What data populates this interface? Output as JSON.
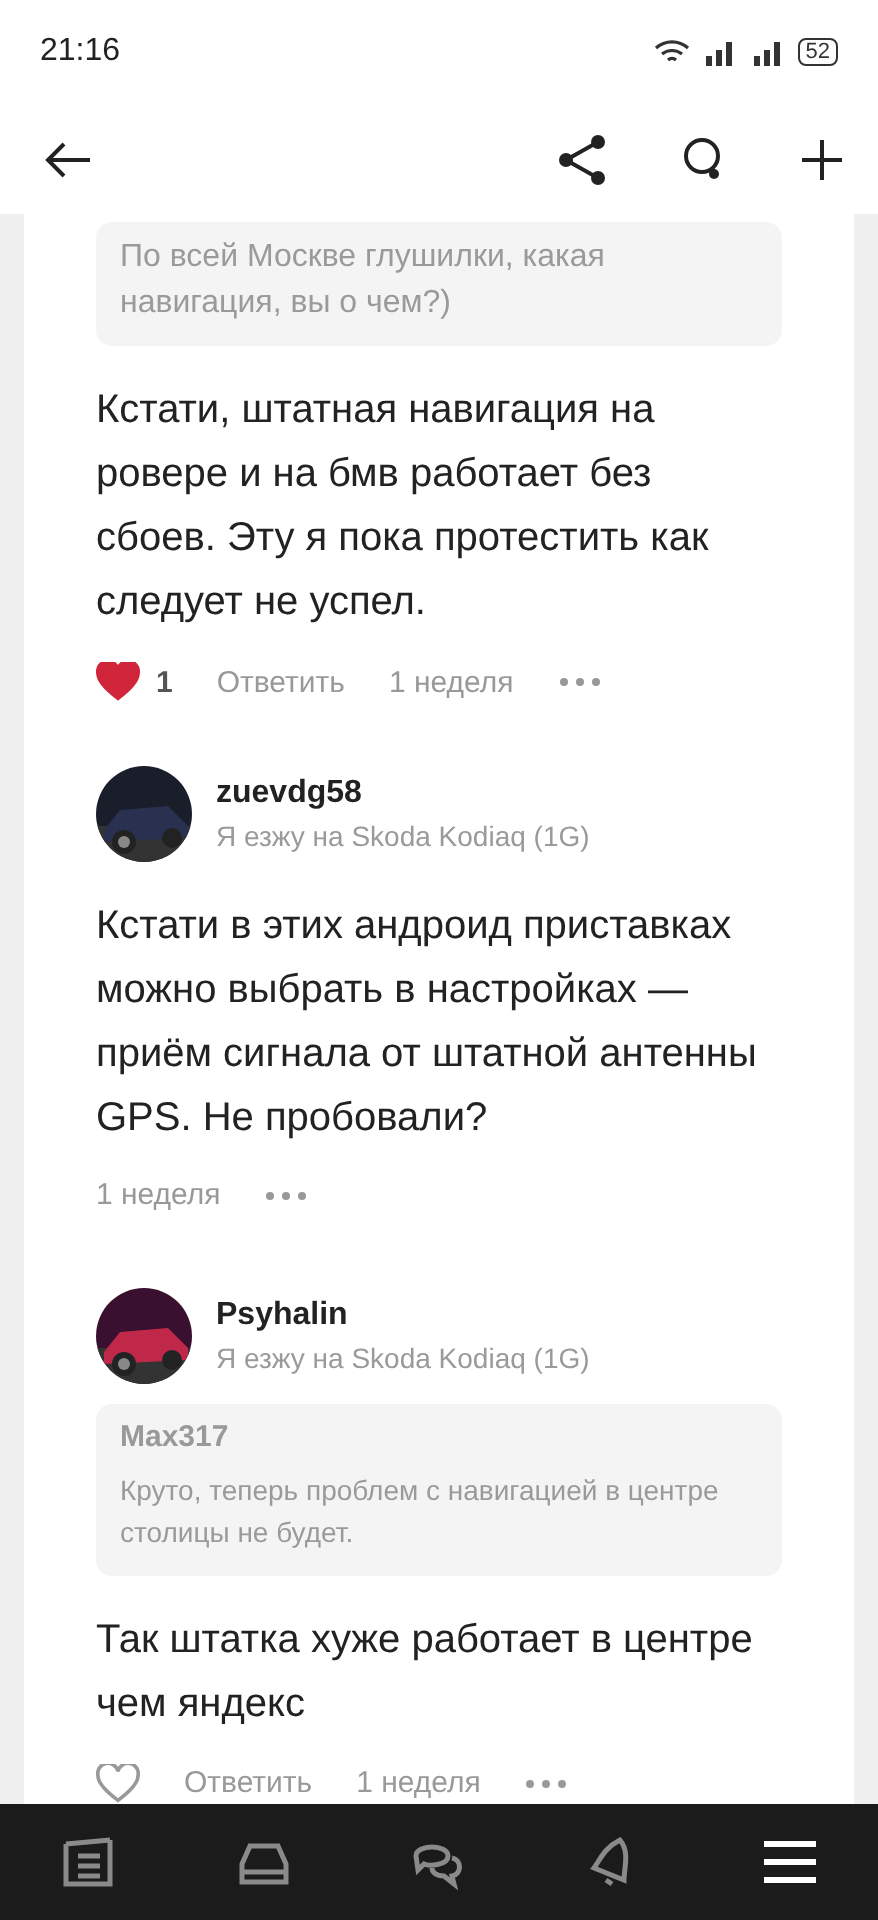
{
  "status_bar": {
    "time": "21:16",
    "battery": "52"
  },
  "comments": [
    {
      "quote": {
        "text": "По всей Москве глушилки, какая навигация, вы о чем?)"
      },
      "body": "Кстати, штатная навигация на ровере и на бмв работает без сбоев. Эту я пока протестить как следует не успел.",
      "liked": true,
      "likes": "1",
      "reply": "Ответить",
      "time": "1 неделя"
    },
    {
      "author": "zuevdg58",
      "car": "Я езжу на Skoda Kodiaq (1G)",
      "body": "Кстати в этих андроид приставках можно выбрать в настройках — приём сигнала от штатной антенны GPS. Не пробовали?",
      "time": "1 неделя"
    },
    {
      "author": "Psyhalin",
      "car": "Я езжу на Skoda Kodiaq (1G)",
      "quote": {
        "author": "Max317",
        "text": "Круто, теперь проблем с навигацией в центре столицы не будет."
      },
      "body": "Так штатка хуже работает в центре чем яндекс",
      "liked": false,
      "reply": "Ответить",
      "time": "1 неделя"
    }
  ],
  "bottom_nav": [
    {
      "kind": "feed",
      "selected": false
    },
    {
      "kind": "car",
      "selected": false
    },
    {
      "kind": "chat",
      "selected": false
    },
    {
      "kind": "bell",
      "selected": false
    },
    {
      "kind": "menu",
      "selected": true
    }
  ]
}
